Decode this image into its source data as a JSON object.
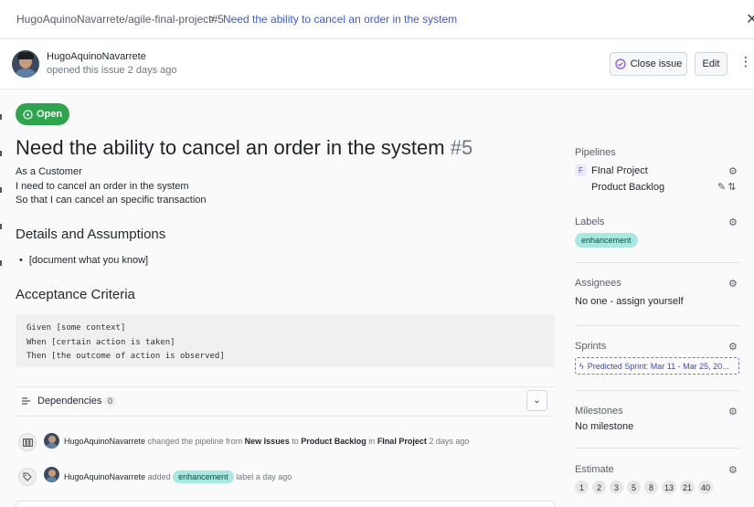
{
  "breadcrumb": {
    "repo": "HugoAquinoNavarrete/agile-final-project#5",
    "sep": "›",
    "title": "Need the ability to cancel an order in the system"
  },
  "header": {
    "author": "HugoAquinoNavarrete",
    "opened": "opened this issue 2 days ago",
    "close_label": "Close issue",
    "edit_label": "Edit",
    "more": "⋮"
  },
  "status": "Open",
  "issue": {
    "title": "Need the ability to cancel an order in the system",
    "number": "#5",
    "description": [
      "As a Customer",
      "I need to cancel an order in the system",
      "So that I can cancel an specific transaction"
    ],
    "details_heading": "Details and Assumptions",
    "details_items": [
      "[document what you know]"
    ],
    "acceptance_heading": "Acceptance Criteria",
    "acceptance_code": [
      "Given [some context]",
      "When [certain action is taken]",
      "Then [the outcome of action is observed]"
    ]
  },
  "dependencies": {
    "label": "Dependencies",
    "count": "0"
  },
  "events": [
    {
      "user": "HugoAquinoNavarrete",
      "action": "changed the pipeline from",
      "from": "New Issues",
      "to_word": "to",
      "to": "Product Backlog",
      "in_word": "in",
      "workspace": "FInal Project",
      "time": "2 days ago"
    },
    {
      "user": "HugoAquinoNavarrete",
      "action": "added",
      "label": "enhancement",
      "suffix": "label a day ago"
    }
  ],
  "sidebar": {
    "pipelines": {
      "heading": "Pipelines",
      "workspace_initial": "F",
      "workspace": "FInal Project",
      "pipeline": "Product Backlog"
    },
    "labels": {
      "heading": "Labels",
      "value": "enhancement"
    },
    "assignees": {
      "heading": "Assignees",
      "value": "No one - ",
      "link": "assign yourself"
    },
    "sprints": {
      "heading": "Sprints",
      "value": "Predicted Sprint: Mar 11 - Mar 25, 20..."
    },
    "milestones": {
      "heading": "Milestones",
      "value": "No milestone"
    },
    "estimate": {
      "heading": "Estimate",
      "values": [
        "1",
        "2",
        "3",
        "5",
        "8",
        "13",
        "21",
        "40"
      ]
    }
  },
  "colors": {
    "open_green": "#2da44e",
    "link_blue": "#3b5bdb",
    "label_teal": "#a7e8e0"
  },
  "icons": [
    "close-icon",
    "check-circle-icon",
    "kebab-icon",
    "open-circle-icon",
    "dependencies-icon",
    "chevron-down-icon",
    "pipeline-icon",
    "tag-icon",
    "gear-icon",
    "pin-icon",
    "move-icon",
    "lightning-icon"
  ]
}
